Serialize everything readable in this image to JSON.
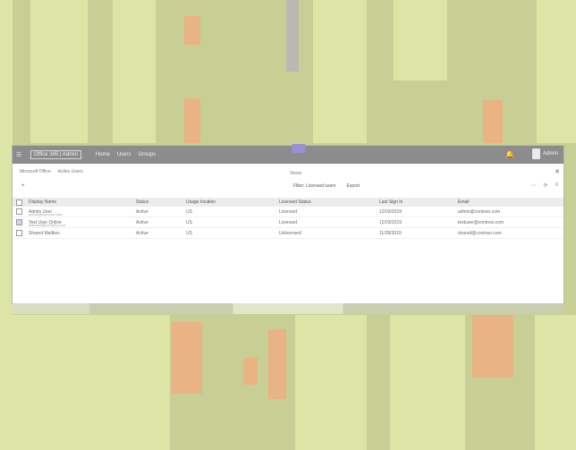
{
  "app": {
    "title": "Office 365 | Admin",
    "menu_icon": "hamburger-icon",
    "nav": [
      "Home",
      "Users",
      "Groups"
    ],
    "notifications_icon": "bell-icon",
    "user_name": "Admin"
  },
  "toolbar": {
    "breadcrumb": [
      "Microsoft Office",
      "Active Users"
    ],
    "scope_label": "Views",
    "close_icon": "close-icon",
    "add_label": "+",
    "filters": [
      "Filter: Licensed users",
      "Export"
    ],
    "view_tools": [
      "⋯",
      "⟳",
      "≡"
    ]
  },
  "table": {
    "columns": [
      "Display Name",
      "Status",
      "Usage location",
      "Licensed Status",
      "Last Sign In",
      "Email"
    ],
    "rows": [
      {
        "name": "Admin User",
        "sub": "admin@contoso.com",
        "status": "Active",
        "location": "US",
        "license": "Licensed",
        "last_sign_in": "12/03/2019",
        "email": "admin@contoso.com",
        "checked": false
      },
      {
        "name": "Test User Online",
        "sub": "testuser@contoso.com",
        "status": "Active",
        "location": "US",
        "license": "Licensed",
        "last_sign_in": "12/03/2019",
        "email": "testuser@contoso.com",
        "checked": true
      },
      {
        "name": "Shared Mailbox",
        "sub": "",
        "status": "Active",
        "location": "US",
        "license": "Unlicensed",
        "last_sign_in": "11/28/2019",
        "email": "shared@contoso.com",
        "checked": false
      }
    ]
  },
  "colors": {
    "titlebar": "#8c8c8c",
    "accent": "#9b8fd0",
    "background": "#c7cf94"
  }
}
